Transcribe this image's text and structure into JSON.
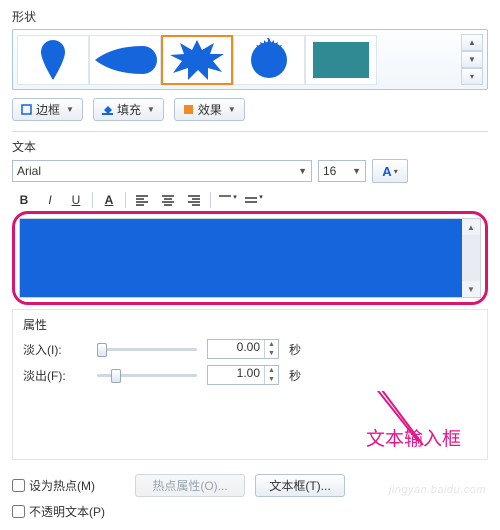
{
  "shape": {
    "label": "形状",
    "items": [
      "pin",
      "drop",
      "burst",
      "seal",
      "rect"
    ],
    "selected_index": 2
  },
  "style_toolbar": {
    "border_label": "边框",
    "fill_label": "填充",
    "effect_label": "效果"
  },
  "text": {
    "section_label": "文本",
    "font_name": "Arial",
    "font_size": "16",
    "format_buttons": {
      "bold": "B",
      "italic": "I",
      "underline": "U",
      "fontA": "A"
    }
  },
  "attributes": {
    "section_label": "属性",
    "fade_in_label": "淡入(I):",
    "fade_in_value": "0.00",
    "fade_out_label": "淡出(F):",
    "fade_out_value": "1.00",
    "unit": "秒"
  },
  "annotation": {
    "label": "文本输入框"
  },
  "hotspot": {
    "set_hotspot_label": "设为热点(M)",
    "hotspot_attr_btn": "热点属性(O)...",
    "textbox_btn": "文本框(T)...",
    "opaque_text_label": "不透明文本(P)"
  },
  "colors": {
    "accent_blue": "#1565dd",
    "highlight_orange": "#f08a24",
    "annotation_pink": "#e51787",
    "seal_teal": "#2f8a94"
  },
  "watermark": "jingyan.baidu.com"
}
